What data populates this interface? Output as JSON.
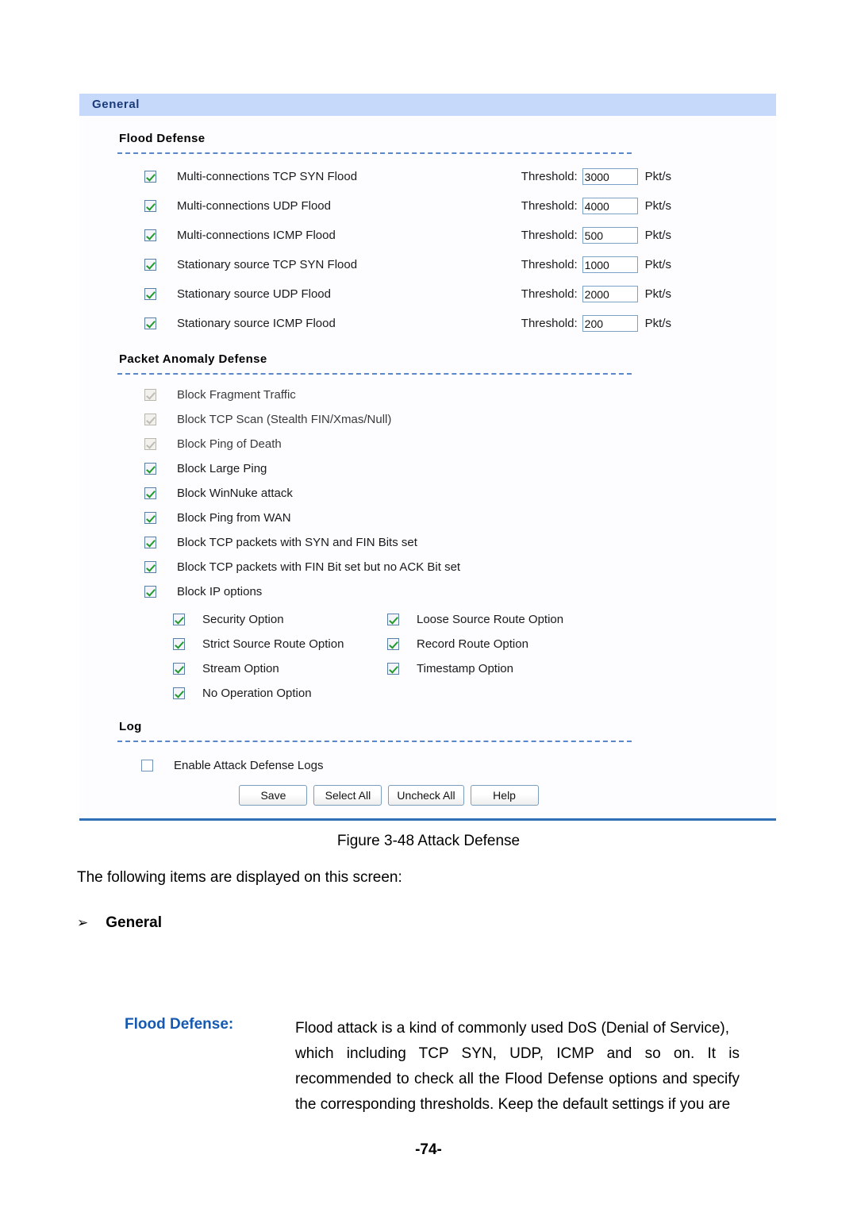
{
  "panel": {
    "header_title": "General",
    "flood_defense": {
      "title": "Flood Defense",
      "threshold_label": "Threshold:",
      "unit_label": "Pkt/s",
      "items": [
        {
          "label": "Multi-connections TCP SYN Flood",
          "checked": true,
          "threshold": "3000"
        },
        {
          "label": "Multi-connections UDP Flood",
          "checked": true,
          "threshold": "4000"
        },
        {
          "label": "Multi-connections ICMP Flood",
          "checked": true,
          "threshold": "500"
        },
        {
          "label": "Stationary source TCP SYN Flood",
          "checked": true,
          "threshold": "1000"
        },
        {
          "label": "Stationary source UDP Flood",
          "checked": true,
          "threshold": "2000"
        },
        {
          "label": "Stationary source ICMP Flood",
          "checked": true,
          "threshold": "200"
        }
      ]
    },
    "packet_anomaly": {
      "title": "Packet Anomaly Defense",
      "items": [
        {
          "label": "Block Fragment Traffic",
          "checked": true,
          "disabled": true
        },
        {
          "label": "Block TCP Scan (Stealth FIN/Xmas/Null)",
          "checked": true,
          "disabled": true
        },
        {
          "label": "Block Ping of Death",
          "checked": true,
          "disabled": true
        },
        {
          "label": "Block Large Ping",
          "checked": true,
          "disabled": false
        },
        {
          "label": "Block WinNuke attack",
          "checked": true,
          "disabled": false
        },
        {
          "label": "Block Ping from WAN",
          "checked": true,
          "disabled": false
        },
        {
          "label": "Block TCP packets with SYN and FIN Bits set",
          "checked": true,
          "disabled": false
        },
        {
          "label": "Block TCP packets with FIN Bit set but no ACK Bit set",
          "checked": true,
          "disabled": false
        },
        {
          "label": "Block IP options",
          "checked": true,
          "disabled": false
        }
      ],
      "ip_options": [
        [
          {
            "label": "Security Option",
            "checked": true
          },
          {
            "label": "Loose Source Route Option",
            "checked": true
          }
        ],
        [
          {
            "label": "Strict Source Route Option",
            "checked": true
          },
          {
            "label": "Record Route Option",
            "checked": true
          }
        ],
        [
          {
            "label": "Stream Option",
            "checked": true
          },
          {
            "label": "Timestamp Option",
            "checked": true
          }
        ],
        [
          {
            "label": "No Operation Option",
            "checked": true
          }
        ]
      ]
    },
    "log": {
      "title": "Log",
      "enable_label": "Enable Attack Defense Logs",
      "enable_checked": false
    },
    "buttons": [
      {
        "label": "Save"
      },
      {
        "label": "Select All"
      },
      {
        "label": "Uncheck All"
      },
      {
        "label": "Help"
      }
    ]
  },
  "document": {
    "figure_caption": "Figure 3-48 Attack Defense",
    "intro_line": "The following items are displayed on this screen:",
    "bullet_arrow": "➢",
    "bullet_heading": "General",
    "term": {
      "label": "Flood Defense:",
      "lines": [
        "Flood attack is a kind of commonly used DoS (Denial of Service),",
        "which including TCP SYN, UDP, ICMP and so on. It is",
        "recommended to check all the Flood Defense options and specify",
        "the corresponding thresholds. Keep the default settings if you are"
      ]
    },
    "page_number": "-74-"
  },
  "colors": {
    "header_bar": "#c6d9fb",
    "header_text": "#1b3a7a",
    "dashed_rule": "#5b87c8",
    "blue_rule": "#2f6fb5",
    "check_green": "#1f9b29",
    "term_label": "#1659b0"
  }
}
